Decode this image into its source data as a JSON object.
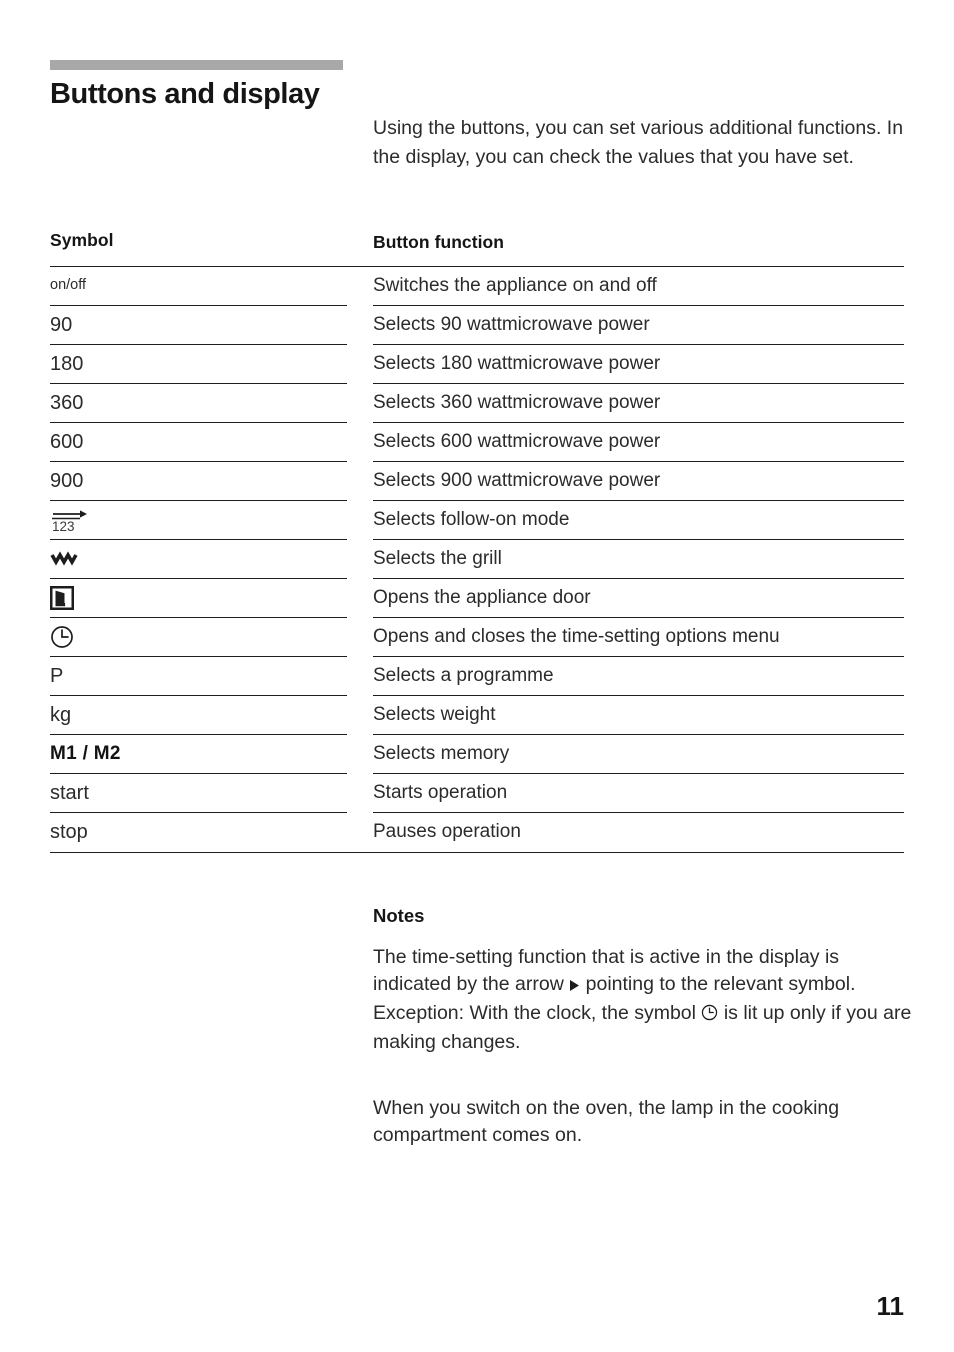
{
  "page": {
    "title": "Buttons and display",
    "number": "11",
    "accent_bar_color": "#a8a8a8",
    "text_color": "#2b2b2b"
  },
  "intro": {
    "text": "Using the buttons, you can set various additional functions. In the display, you can check the values that you have set."
  },
  "table": {
    "headers": {
      "symbol": "Symbol",
      "function": "Button function"
    },
    "rows": [
      {
        "symbol": "on/off",
        "symbol_kind": "text-small",
        "icon": "",
        "function": "Switches the appliance on and off"
      },
      {
        "symbol": "90",
        "symbol_kind": "text",
        "icon": "",
        "function": "Selects 90 wattmicrowave power"
      },
      {
        "symbol": "180",
        "symbol_kind": "text",
        "icon": "",
        "function": "Selects 180 wattmicrowave power"
      },
      {
        "symbol": "360",
        "symbol_kind": "text",
        "icon": "",
        "function": "Selects 360 wattmicrowave power"
      },
      {
        "symbol": "600",
        "symbol_kind": "text",
        "icon": "",
        "function": "Selects 600 wattmicrowave power"
      },
      {
        "symbol": "900",
        "symbol_kind": "text",
        "icon": "",
        "function": "Selects 900 wattmicrowave power"
      },
      {
        "symbol": "123",
        "symbol_kind": "icon",
        "icon": "arrow-over-123-icon",
        "function": "Selects follow-on mode"
      },
      {
        "symbol": "",
        "symbol_kind": "icon",
        "icon": "grill-wave-icon",
        "function": "Selects the grill"
      },
      {
        "symbol": "",
        "symbol_kind": "icon",
        "icon": "door-open-icon",
        "function": "Opens the appliance door"
      },
      {
        "symbol": "",
        "symbol_kind": "icon",
        "icon": "clock-icon",
        "function": "Opens and closes the time-setting options menu"
      },
      {
        "symbol": "P",
        "symbol_kind": "text",
        "icon": "",
        "function": "Selects a programme"
      },
      {
        "symbol": "kg",
        "symbol_kind": "text",
        "icon": "",
        "function": "Selects weight"
      },
      {
        "symbol": "M1 / M2",
        "symbol_kind": "text-bold",
        "icon": "",
        "function": "Selects memory"
      },
      {
        "symbol": "start",
        "symbol_kind": "text",
        "icon": "",
        "function": "Starts operation"
      },
      {
        "symbol": "stop",
        "symbol_kind": "text",
        "icon": "",
        "function": "Pauses operation"
      }
    ]
  },
  "notes": {
    "heading": "Notes",
    "paragraph1_part1": "The time-setting function that is active in the display is indicated by the arrow",
    "paragraph1_arrow_icon": "right-triangle-arrow-icon",
    "paragraph1_part2": "pointing to the relevant symbol.",
    "paragraph1_part3": "Exception: With the clock, the symbol",
    "paragraph1_clock_icon": "clock-icon",
    "paragraph1_part4": "is lit up only if you are making changes.",
    "paragraph2": "When you switch on the oven, the lamp in the cooking compartment comes on."
  }
}
